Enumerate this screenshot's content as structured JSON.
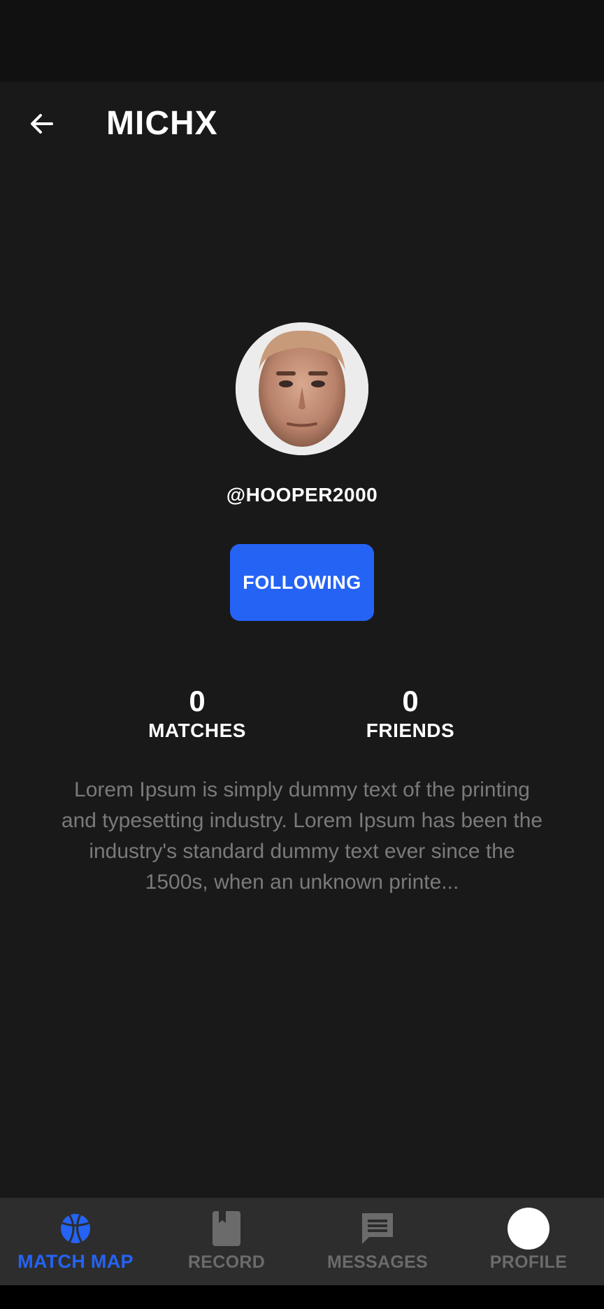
{
  "header": {
    "title": "MICHX"
  },
  "profile": {
    "username": "@HOOPER2000",
    "follow_label": "FOLLOWING",
    "stats": {
      "matches_value": "0",
      "matches_label": "MATCHES",
      "friends_value": "0",
      "friends_label": "FRIENDS"
    },
    "bio": "Lorem Ipsum is simply dummy text of the printing and typesetting industry. Lorem Ipsum has been the industry's standard dummy text ever since the 1500s, when an unknown printe..."
  },
  "nav": {
    "items": [
      {
        "label": "MATCH MAP",
        "icon": "basketball-icon",
        "active": true
      },
      {
        "label": "RECORD",
        "icon": "book-icon",
        "active": false
      },
      {
        "label": "MESSAGES",
        "icon": "chat-icon",
        "active": false
      },
      {
        "label": "PROFILE",
        "icon": "profile-avatar-icon",
        "active": false
      }
    ]
  },
  "colors": {
    "background": "#191919",
    "accent": "#2563f5",
    "nav_background": "#2d2d2d",
    "nav_inactive": "#6b6b6b",
    "bio_text": "#7a7a7a"
  }
}
